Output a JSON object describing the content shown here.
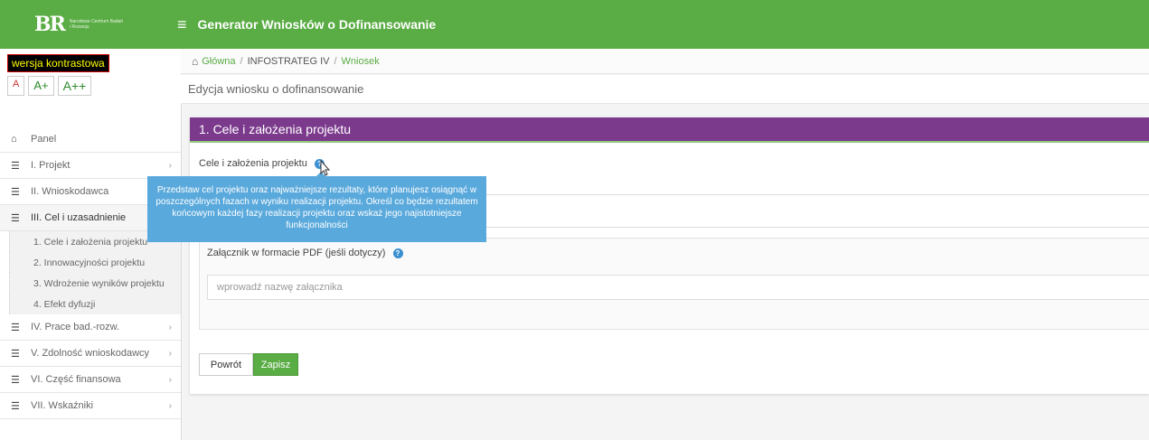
{
  "header": {
    "logo_mark": "BR",
    "logo_text": "Narodowe Centrum Badań i Rozwoju",
    "app_title": "Generator Wniosków o Dofinansowanie"
  },
  "accessibility": {
    "contrast_label": "wersja kontrastowa",
    "font_small": "A",
    "font_medium": "A+",
    "font_large": "A++"
  },
  "nav": {
    "items": [
      {
        "label": "Panel",
        "icon": "home-icon"
      },
      {
        "label": "I. Projekt",
        "icon": "list-icon",
        "chevron": "›"
      },
      {
        "label": "II. Wnioskodawca",
        "icon": "list-icon",
        "chevron": "›"
      },
      {
        "label": "III. Cel i uzasadnienie",
        "icon": "list-icon",
        "chevron": "‹"
      }
    ],
    "sub_items": [
      {
        "label": "1. Cele i założenia projektu"
      },
      {
        "label": "2. Innowacyjności projektu"
      },
      {
        "label": "3. Wdrożenie wyników projektu"
      },
      {
        "label": "4. Efekt dyfuzji"
      }
    ],
    "items_after": [
      {
        "label": "IV. Prace bad.-rozw.",
        "icon": "list-icon",
        "chevron": "›"
      },
      {
        "label": "V. Zdolność wnioskodawcy",
        "icon": "list-icon",
        "chevron": "›"
      },
      {
        "label": "VI. Część finansowa",
        "icon": "list-icon",
        "chevron": "›"
      },
      {
        "label": "VII. Wskaźniki",
        "icon": "list-icon",
        "chevron": "›"
      }
    ]
  },
  "breadcrumb": {
    "home": "Główna",
    "mid": "INFOSTRATEG IV",
    "current": "Wniosek",
    "sep": "/"
  },
  "page": {
    "title": "Edycja wniosku o dofinansowanie"
  },
  "panel": {
    "title": "1. Cele i założenia projektu",
    "field_label": "Cele i założenia projektu",
    "tooltip": "Przedstaw cel projektu oraz najważniejsze rezultaty, które planujesz osiągnąć w poszczególnych fazach w wyniku realizacji projektu. Określ co będzie rezultatem końcowym każdej fazy realizacji projektu oraz wskaż jego najistotniejsze funkcjonalności",
    "attach_label": "Załącznik w formacie PDF (jeśli dotyczy)",
    "attach_placeholder": "wprowadź nazwę załącznika",
    "back_label": "Powrót",
    "save_label": "Zapisz"
  },
  "colors": {
    "topbar": "#5aac44",
    "panel_header": "#7b3a8c",
    "tooltip": "#5aa9dc"
  }
}
